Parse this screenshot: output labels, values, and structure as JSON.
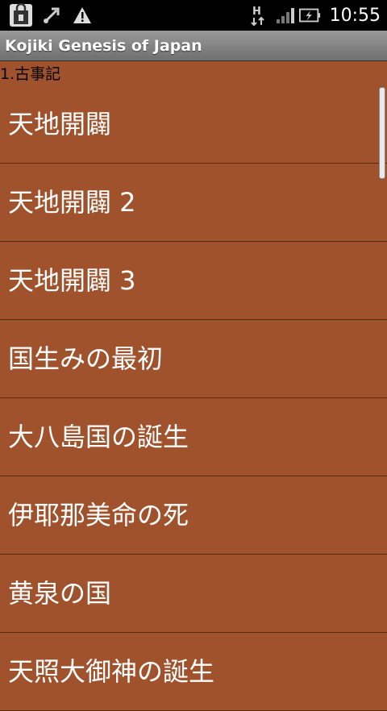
{
  "status_bar": {
    "icons_left": [
      "shopping-bag-icon",
      "usb-debug-icon",
      "warning-icon"
    ],
    "network_label": "H",
    "time": "10:55"
  },
  "app": {
    "title": "Kojiki Genesis of Japan"
  },
  "section": {
    "header": "1.古事記"
  },
  "list": {
    "items": [
      {
        "label": "天地開闢"
      },
      {
        "label": "天地開闢 2"
      },
      {
        "label": "天地開闢 3"
      },
      {
        "label": "国生みの最初"
      },
      {
        "label": "大八島国の誕生"
      },
      {
        "label": "伊耶那美命の死"
      },
      {
        "label": "黄泉の国"
      },
      {
        "label": "天照大御神の誕生"
      }
    ]
  },
  "colors": {
    "background": "#a0522d",
    "item_text": "#ffffff",
    "divider": "#5a2a10"
  }
}
